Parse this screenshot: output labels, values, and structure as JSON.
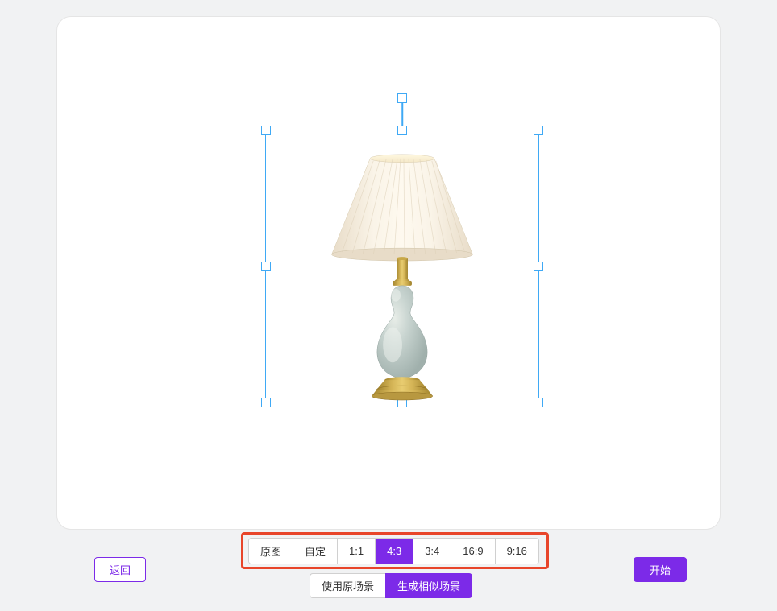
{
  "buttons": {
    "back": "返回",
    "start": "开始"
  },
  "ratios": [
    {
      "label": "原图",
      "active": false
    },
    {
      "label": "自定",
      "active": false
    },
    {
      "label": "1:1",
      "active": false
    },
    {
      "label": "4:3",
      "active": true
    },
    {
      "label": "3:4",
      "active": false
    },
    {
      "label": "16:9",
      "active": false
    },
    {
      "label": "9:16",
      "active": false
    }
  ],
  "scenes": {
    "use_original": "使用原场景",
    "generate_similar": "生成相似场景"
  },
  "colors": {
    "accent": "#7c2ae8",
    "selection": "#3fa9f5",
    "highlight": "#e8452a"
  },
  "canvas": {
    "content_type": "table-lamp-image"
  }
}
